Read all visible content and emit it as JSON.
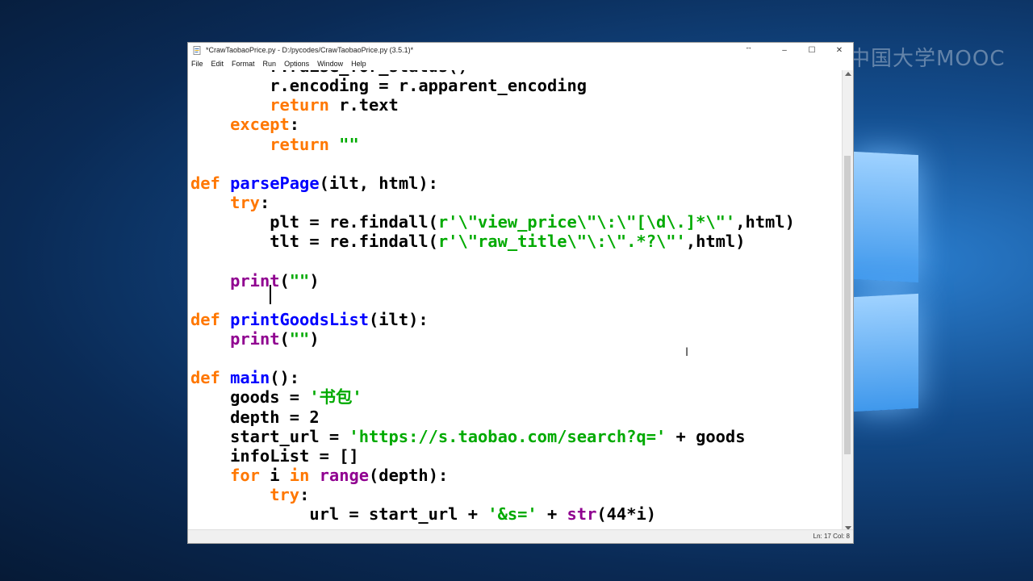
{
  "window": {
    "title": "*CrawTaobaoPrice.py - D:/pycodes/CrawTaobaoPrice.py (3.5.1)*",
    "controls": {
      "minimize": "–",
      "maximize": "☐",
      "close": "✕"
    }
  },
  "menu": [
    "File",
    "Edit",
    "Format",
    "Run",
    "Options",
    "Window",
    "Help"
  ],
  "code_lines": [
    [
      [
        "",
        "        r.raise_for_status()"
      ]
    ],
    [
      [
        "",
        "        r.encoding = r.apparent_encoding"
      ]
    ],
    [
      [
        "",
        "        "
      ],
      [
        "k",
        "return"
      ],
      [
        "",
        " r.text"
      ]
    ],
    [
      [
        "",
        "    "
      ],
      [
        "k",
        "except"
      ],
      [
        "",
        ":"
      ]
    ],
    [
      [
        "",
        "        "
      ],
      [
        "k",
        "return"
      ],
      [
        "",
        " "
      ],
      [
        "s",
        "\"\""
      ]
    ],
    [
      [
        "",
        ""
      ]
    ],
    [
      [
        "k",
        "def"
      ],
      [
        "",
        " "
      ],
      [
        "d",
        "parsePage"
      ],
      [
        "",
        "(ilt, html):"
      ]
    ],
    [
      [
        "",
        "    "
      ],
      [
        "k",
        "try"
      ],
      [
        "",
        ":"
      ]
    ],
    [
      [
        "",
        "        plt = re.findall("
      ],
      [
        "s",
        "r'\\\"view_price\\\"\\:\\\"[\\d\\.]*\\\"'"
      ],
      [
        "",
        ",html)"
      ]
    ],
    [
      [
        "",
        "        tlt = re.findall("
      ],
      [
        "s",
        "r'\\\"raw_title\\\"\\:\\\".*?\\\"'"
      ],
      [
        "",
        ",html)"
      ]
    ],
    [
      [
        "",
        "        "
      ]
    ],
    [
      [
        "",
        "    "
      ],
      [
        "b",
        "print"
      ],
      [
        "",
        "("
      ],
      [
        "s",
        "\"\""
      ],
      [
        "",
        ")"
      ]
    ],
    [
      [
        "",
        ""
      ]
    ],
    [
      [
        "k",
        "def"
      ],
      [
        "",
        " "
      ],
      [
        "d",
        "printGoodsList"
      ],
      [
        "",
        "(ilt):"
      ]
    ],
    [
      [
        "",
        "    "
      ],
      [
        "b",
        "print"
      ],
      [
        "",
        "("
      ],
      [
        "s",
        "\"\""
      ],
      [
        "",
        ")"
      ]
    ],
    [
      [
        "",
        ""
      ]
    ],
    [
      [
        "k",
        "def"
      ],
      [
        "",
        " "
      ],
      [
        "d",
        "main"
      ],
      [
        "",
        "():"
      ]
    ],
    [
      [
        "",
        "    goods = "
      ],
      [
        "s",
        "'书包'"
      ]
    ],
    [
      [
        "",
        "    depth = 2"
      ]
    ],
    [
      [
        "",
        "    start_url = "
      ],
      [
        "s",
        "'https://s.taobao.com/search?q='"
      ],
      [
        "",
        " + goods"
      ]
    ],
    [
      [
        "",
        "    infoList = []"
      ]
    ],
    [
      [
        "",
        "    "
      ],
      [
        "k",
        "for"
      ],
      [
        "",
        " i "
      ],
      [
        "k",
        "in"
      ],
      [
        "",
        " "
      ],
      [
        "b",
        "range"
      ],
      [
        "",
        "(depth):"
      ]
    ],
    [
      [
        "",
        "        "
      ],
      [
        "k",
        "try"
      ],
      [
        "",
        ":"
      ]
    ],
    [
      [
        "",
        "            url = start_url + "
      ],
      [
        "s",
        "'&s='"
      ],
      [
        "",
        " + "
      ],
      [
        "b",
        "str"
      ],
      [
        "",
        "(44*i)"
      ]
    ]
  ],
  "status": {
    "position": "Ln: 17   Col: 8"
  },
  "colors": {
    "keyword": "#ff7700",
    "definition": "#0000ff",
    "string": "#00aa00",
    "builtin": "#900090"
  },
  "watermark": "中国大学MOOC"
}
